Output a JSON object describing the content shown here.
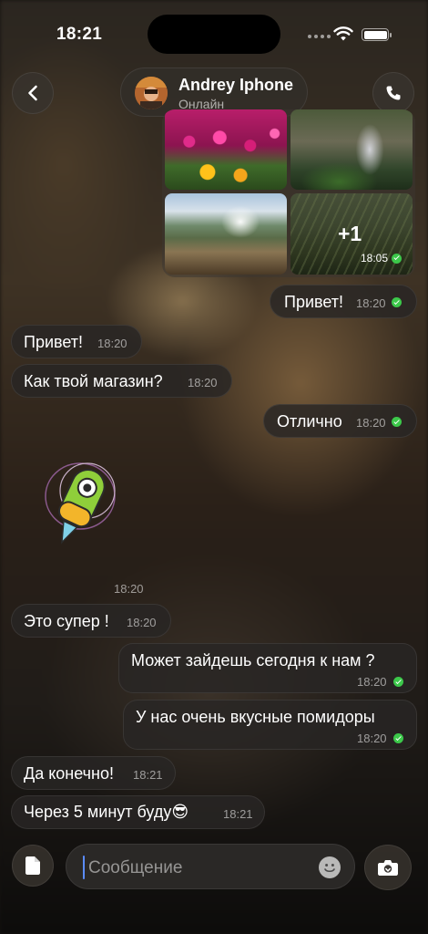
{
  "status_bar": {
    "time": "18:21"
  },
  "header": {
    "contact_name": "Andrey Iphone",
    "contact_status": "Онлайн",
    "back_icon": "chevron-left-icon",
    "call_icon": "phone-icon"
  },
  "photo_album": {
    "extra_count": "+1",
    "time": "18:05",
    "read": true
  },
  "messages": [
    {
      "text": "Привет!",
      "time": "18:20",
      "outgoing": true,
      "read": true
    },
    {
      "text": "Привет!",
      "time": "18:20",
      "outgoing": false
    },
    {
      "text": "Как твой магазин?",
      "time": "18:20",
      "outgoing": false
    },
    {
      "text": "Отлично",
      "time": "18:20",
      "outgoing": true,
      "read": true
    },
    {
      "text": "Это супер !",
      "time": "18:20",
      "outgoing": false
    },
    {
      "text": "Может зайдешь сегодня к нам ?",
      "time": "18:20",
      "outgoing": true,
      "read": true
    },
    {
      "text": "У нас очень вкусные помидоры",
      "time": "18:20",
      "outgoing": true,
      "read": true
    },
    {
      "text": "Да конечно!",
      "time": "18:21",
      "outgoing": false
    },
    {
      "text": "Через 5 минут буду😎",
      "time": "18:21",
      "outgoing": false
    }
  ],
  "sticker": {
    "time": "18:20"
  },
  "composer": {
    "placeholder": "Сообщение",
    "attach_icon": "document-icon",
    "emoji_icon": "smiley-icon",
    "camera_icon": "camera-icon"
  },
  "colors": {
    "read_check": "#3cc84a",
    "caret": "#5b8cff"
  }
}
